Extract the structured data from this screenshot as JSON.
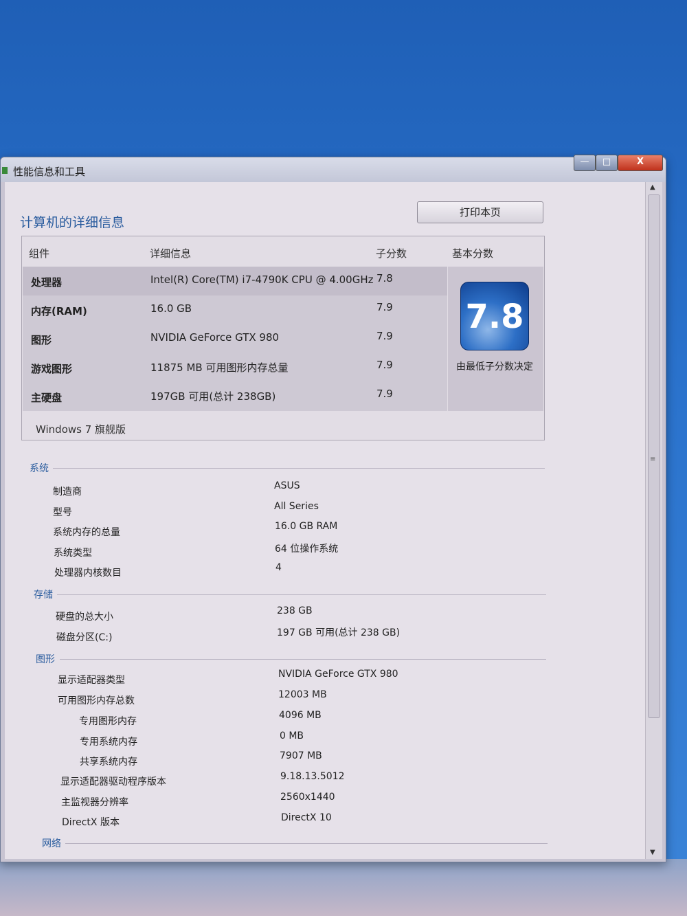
{
  "window": {
    "title": "性能信息和工具",
    "controls": {
      "minimize": "—",
      "maximize": "□",
      "close": "X"
    }
  },
  "header": {
    "title": "计算机的详细信息",
    "print_button": "打印本页"
  },
  "score_table": {
    "columns": {
      "component": "组件",
      "details": "详细信息",
      "subscore": "子分数",
      "base_score": "基本分数"
    },
    "rows": [
      {
        "component": "处理器",
        "details": "Intel(R) Core(TM) i7-4790K CPU @ 4.00GHz",
        "subscore": "7.8"
      },
      {
        "component": "内存(RAM)",
        "details": "16.0 GB",
        "subscore": "7.9"
      },
      {
        "component": "图形",
        "details": "NVIDIA GeForce GTX 980",
        "subscore": "7.9"
      },
      {
        "component": "游戏图形",
        "details": "11875 MB 可用图形内存总量",
        "subscore": "7.9"
      },
      {
        "component": "主硬盘",
        "details": "197GB 可用(总计 238GB)",
        "subscore": "7.9"
      }
    ],
    "base_score": "7.8",
    "base_note": "由最低子分数决定",
    "os_edition": "Windows 7 旗舰版"
  },
  "sections": {
    "system": {
      "title": "系统",
      "items": [
        {
          "key": "制造商",
          "value": "ASUS"
        },
        {
          "key": "型号",
          "value": "All Series"
        },
        {
          "key": "系统内存的总量",
          "value": "16.0 GB RAM"
        },
        {
          "key": "系统类型",
          "value": "64 位操作系统"
        },
        {
          "key": "处理器内核数目",
          "value": "4"
        }
      ]
    },
    "storage": {
      "title": "存储",
      "items": [
        {
          "key": "硬盘的总大小",
          "value": "238 GB"
        },
        {
          "key": "磁盘分区(C:)",
          "value": "197 GB 可用(总计 238 GB)"
        }
      ]
    },
    "graphics": {
      "title": "图形",
      "items": [
        {
          "key": "显示适配器类型",
          "value": "NVIDIA GeForce GTX 980"
        },
        {
          "key": "可用图形内存总数",
          "value": "12003 MB"
        },
        {
          "key": "专用图形内存",
          "value": "4096 MB"
        },
        {
          "key": "专用系统内存",
          "value": "0 MB"
        },
        {
          "key": "共享系统内存",
          "value": "7907 MB"
        },
        {
          "key": "显示适配器驱动程序版本",
          "value": "9.18.13.5012"
        },
        {
          "key": "主监视器分辨率",
          "value": "2560x1440"
        },
        {
          "key": "DirectX 版本",
          "value": "DirectX 10"
        }
      ]
    },
    "network": {
      "title": "网络"
    }
  },
  "scrollbar": {
    "up": "▲",
    "down": "▼",
    "grip": "≡"
  }
}
